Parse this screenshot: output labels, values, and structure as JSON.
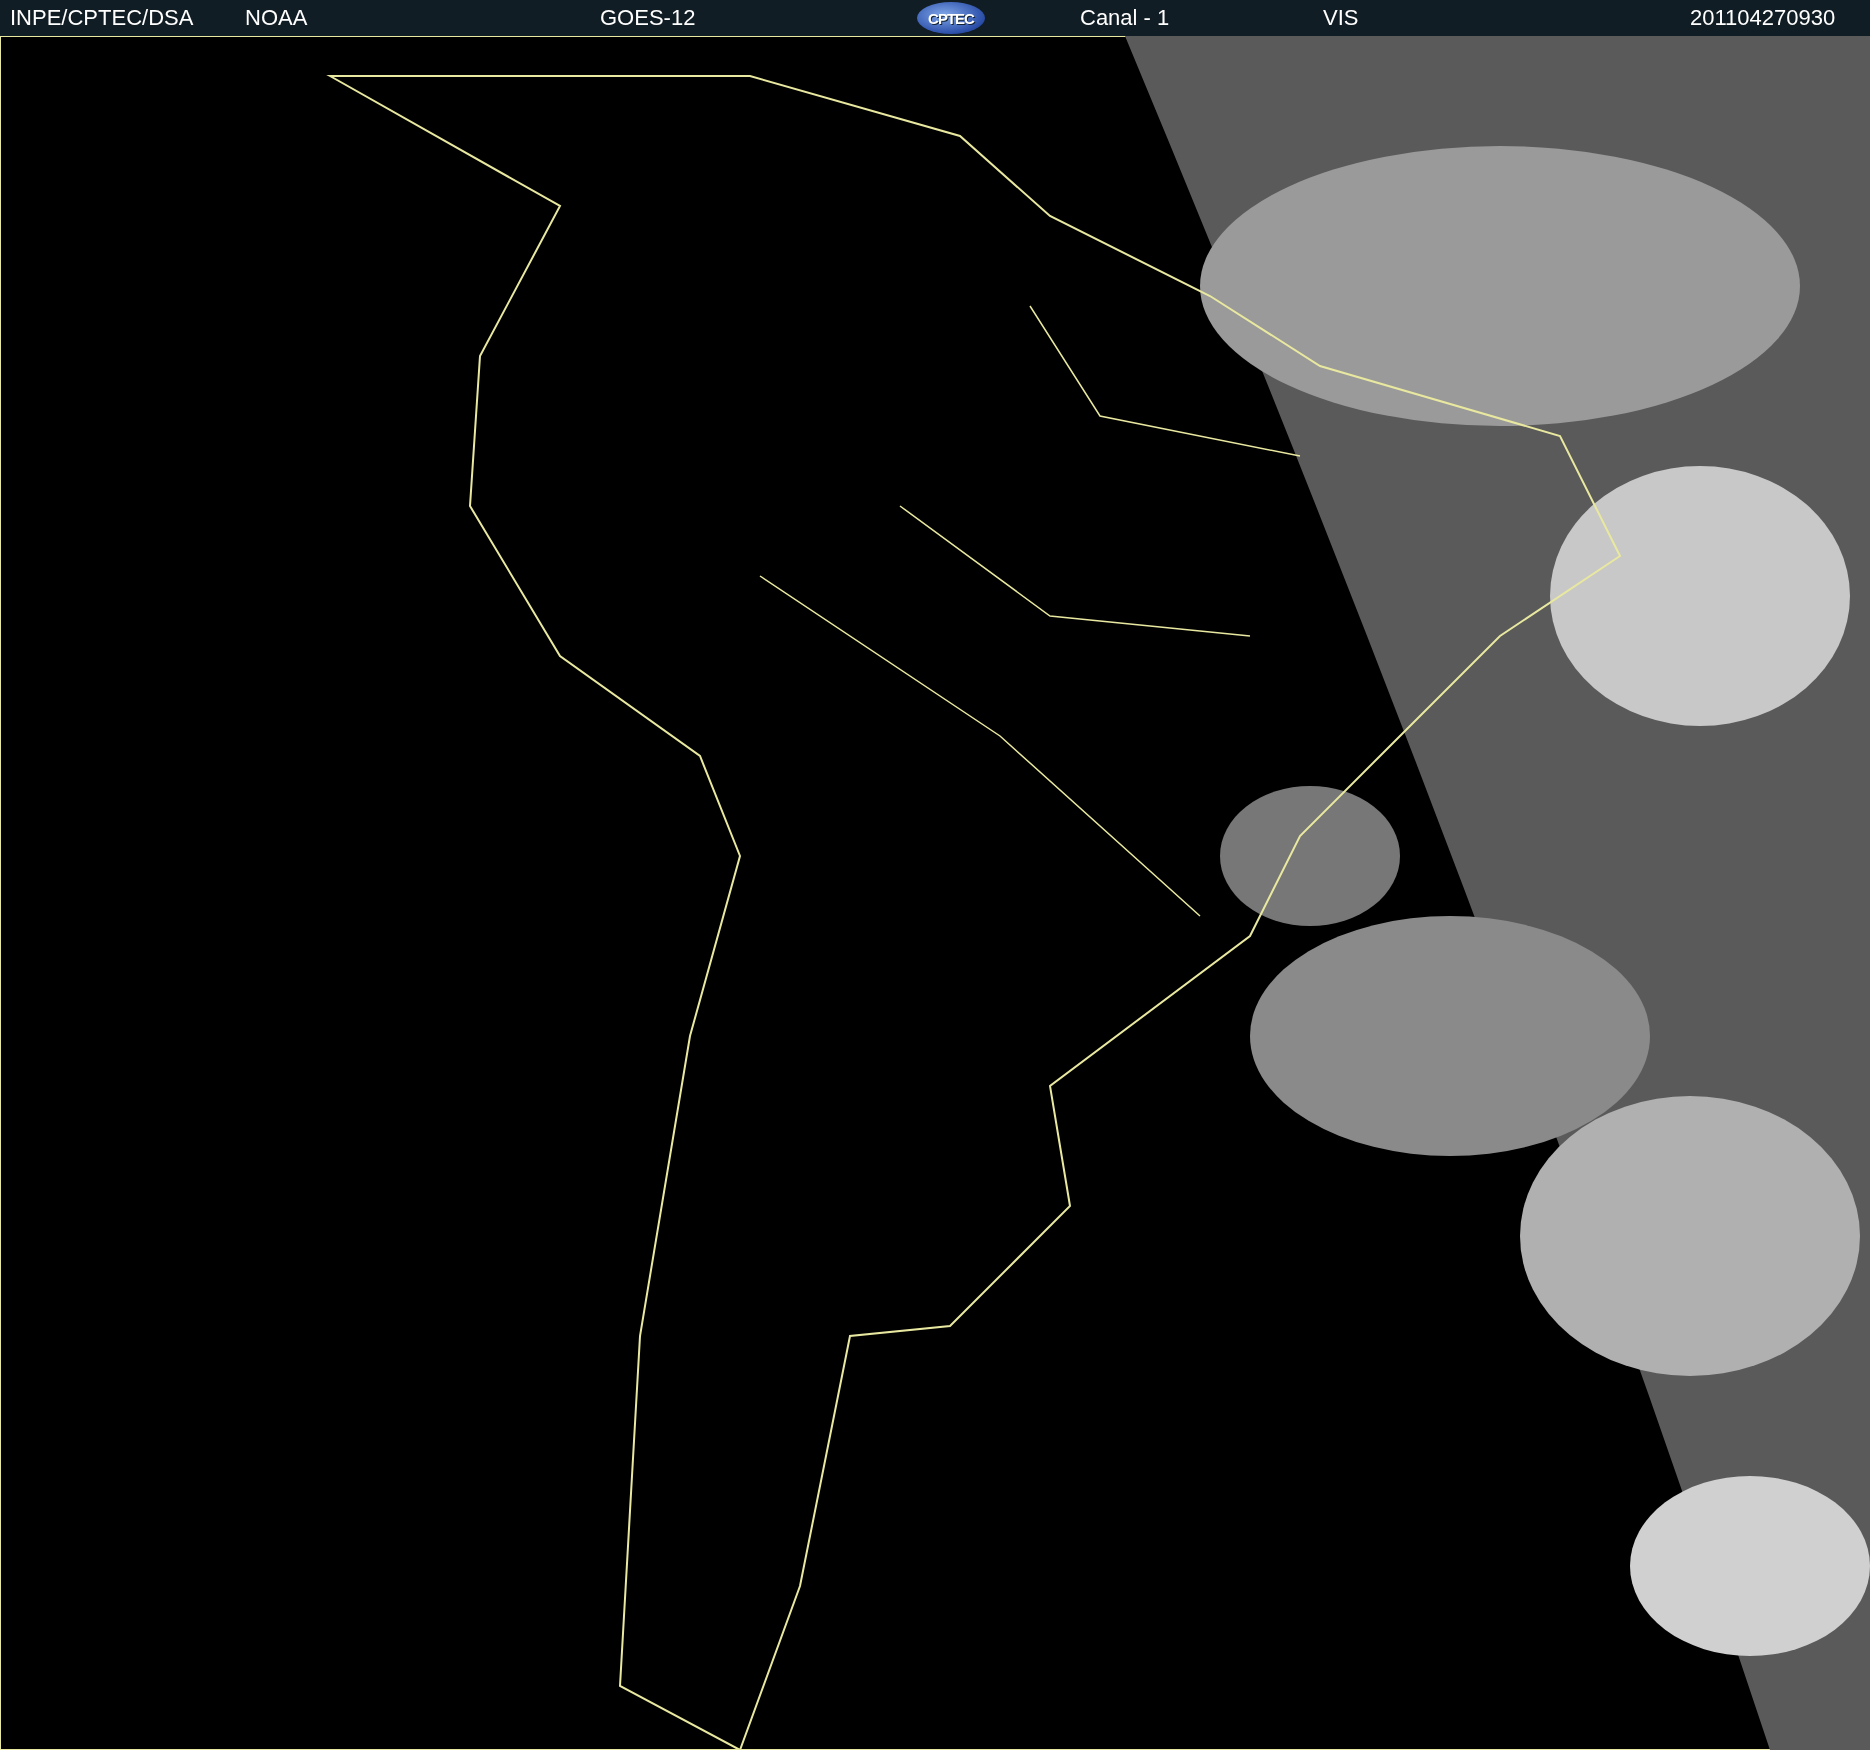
{
  "header": {
    "items": [
      {
        "kind": "text",
        "text": "INPE/CPTEC/DSA"
      },
      {
        "kind": "text",
        "text": "NOAA"
      },
      {
        "kind": "text",
        "text": "GOES-12"
      },
      {
        "kind": "logo",
        "text": "CPTEC"
      },
      {
        "kind": "text",
        "text": "Canal - 1"
      },
      {
        "kind": "text",
        "text": "VIS"
      },
      {
        "kind": "text",
        "text": "201104270930"
      }
    ]
  }
}
